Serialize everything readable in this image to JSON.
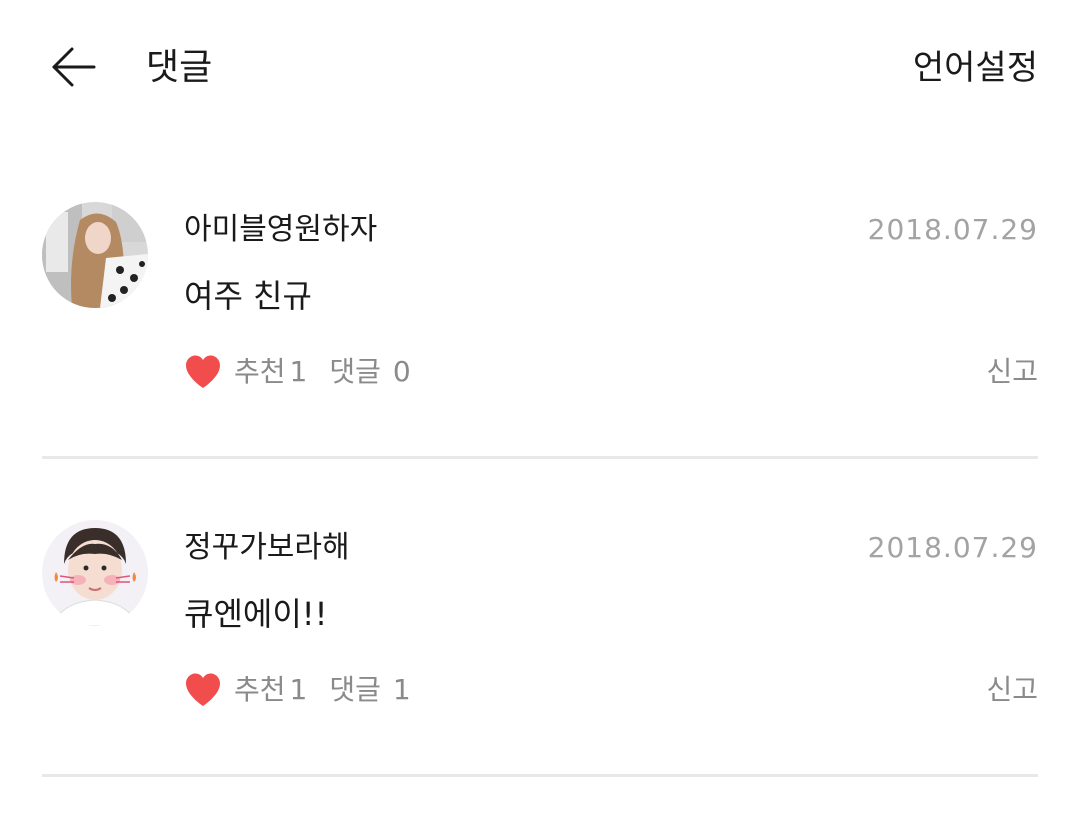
{
  "header": {
    "title": "댓글",
    "language_button": "언어설정"
  },
  "comments": [
    {
      "username": "아미블영원하자",
      "date": "2018.07.29",
      "content": "여주 친규",
      "like_label": "추천",
      "like_count": "1",
      "reply_label": "댓글",
      "reply_count": "0",
      "report_label": "신고"
    },
    {
      "username": "정꾸가보라해",
      "date": "2018.07.29",
      "content": "큐엔에이!!",
      "like_label": "추천",
      "like_count": "1",
      "reply_label": "댓글",
      "reply_count": "1",
      "report_label": "신고"
    }
  ],
  "colors": {
    "heart": "#f24d4d",
    "date": "#a3a3a3",
    "meta": "#8a8a8a",
    "divider": "#e8e8e8"
  }
}
